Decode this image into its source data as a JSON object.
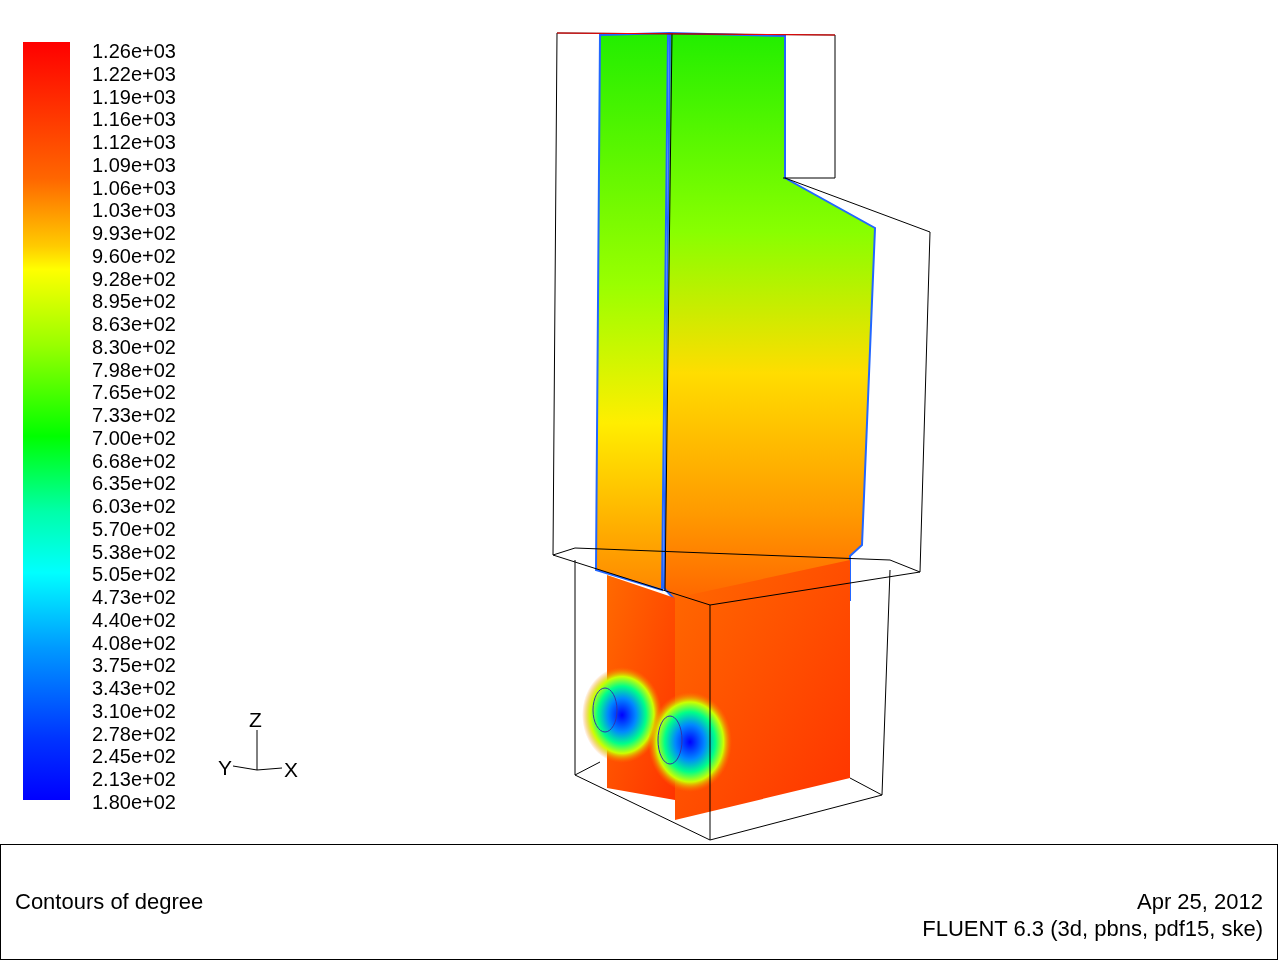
{
  "legend": {
    "labels": [
      "1.26e+03",
      "1.22e+03",
      "1.19e+03",
      "1.16e+03",
      "1.12e+03",
      "1.09e+03",
      "1.06e+03",
      "1.03e+03",
      "9.93e+02",
      "9.60e+02",
      "9.28e+02",
      "8.95e+02",
      "8.63e+02",
      "8.30e+02",
      "7.98e+02",
      "7.65e+02",
      "7.33e+02",
      "7.00e+02",
      "6.68e+02",
      "6.35e+02",
      "6.03e+02",
      "5.70e+02",
      "5.38e+02",
      "5.05e+02",
      "4.73e+02",
      "4.40e+02",
      "4.08e+02",
      "3.75e+02",
      "3.43e+02",
      "3.10e+02",
      "2.78e+02",
      "2.45e+02",
      "2.13e+02",
      "1.80e+02"
    ]
  },
  "triad": {
    "z": "Z",
    "y": "Y",
    "x": "X"
  },
  "info": {
    "title": "Contours of degree",
    "date": "Apr 25, 2012",
    "version": "FLUENT 6.3 (3d, pbns, pdf15, ske)"
  }
}
